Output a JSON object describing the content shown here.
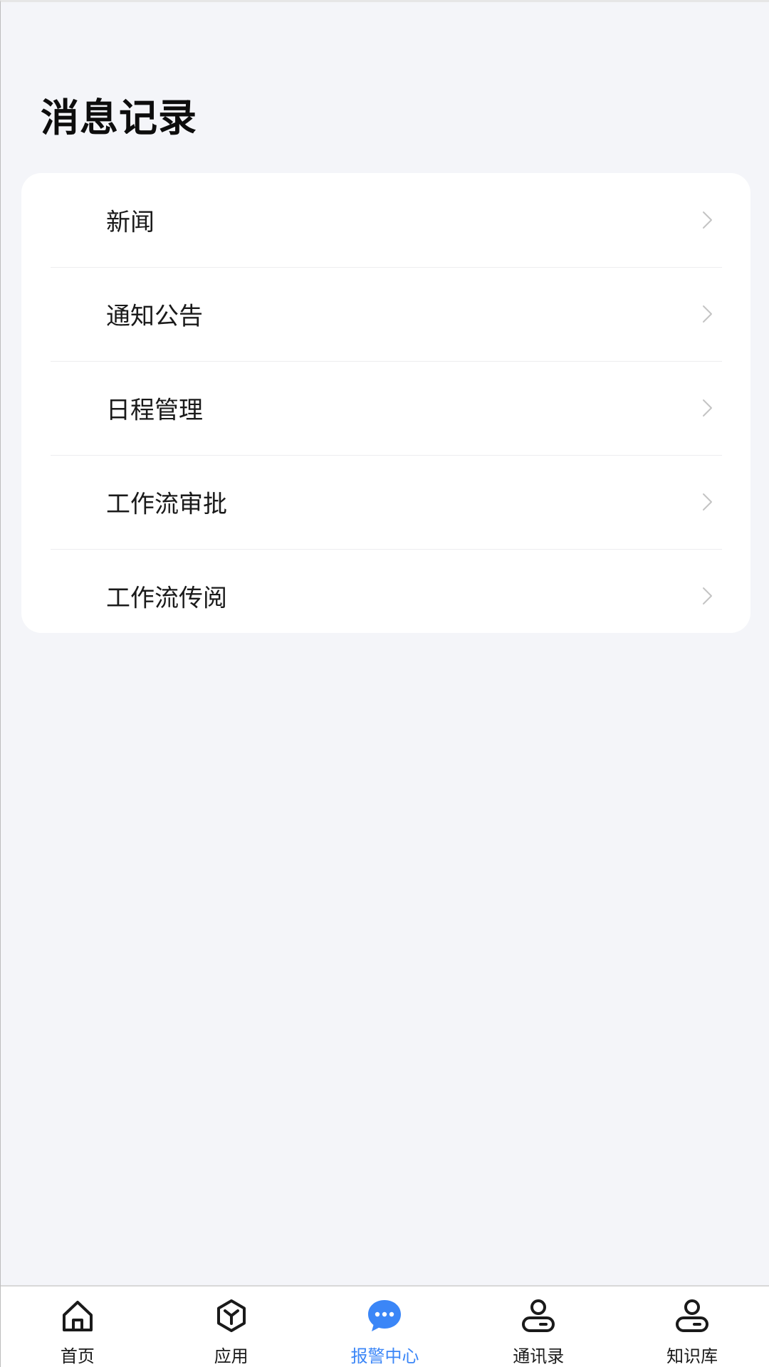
{
  "page": {
    "title": "消息记录"
  },
  "menu": {
    "items": [
      {
        "label": "新闻"
      },
      {
        "label": "通知公告"
      },
      {
        "label": "日程管理"
      },
      {
        "label": "工作流审批"
      },
      {
        "label": "工作流传阅"
      }
    ],
    "chevron_icon": "chevron-right-icon"
  },
  "tab_bar": {
    "active_index": 2,
    "accent_color": "#3b86f7",
    "tabs": [
      {
        "label": "首页",
        "icon": "home-icon"
      },
      {
        "label": "应用",
        "icon": "cube-icon"
      },
      {
        "label": "报警中心",
        "icon": "chat-bubble-icon"
      },
      {
        "label": "通讯录",
        "icon": "person-icon"
      },
      {
        "label": "知识库",
        "icon": "person-icon"
      }
    ]
  }
}
